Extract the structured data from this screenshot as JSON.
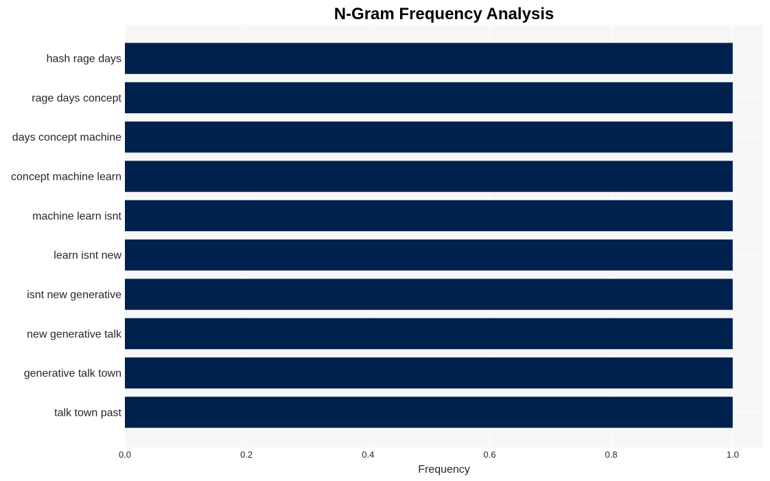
{
  "chart_data": {
    "type": "bar",
    "orientation": "horizontal",
    "title": "N-Gram Frequency Analysis",
    "xlabel": "Frequency",
    "ylabel": "",
    "categories": [
      "hash rage days",
      "rage days concept",
      "days concept machine",
      "concept machine learn",
      "machine learn isnt",
      "learn isnt new",
      "isnt new generative",
      "new generative talk",
      "generative talk town",
      "talk town past"
    ],
    "values": [
      1,
      1,
      1,
      1,
      1,
      1,
      1,
      1,
      1,
      1
    ],
    "xlim": [
      0,
      1.05
    ],
    "xticks": [
      "0.0",
      "0.2",
      "0.4",
      "0.6",
      "0.8",
      "1.0"
    ],
    "grid": true,
    "legend": "none",
    "colors": {
      "bar": "#00204e",
      "plot_bg": "#f7f7f7",
      "grid": "#ffffff"
    }
  }
}
